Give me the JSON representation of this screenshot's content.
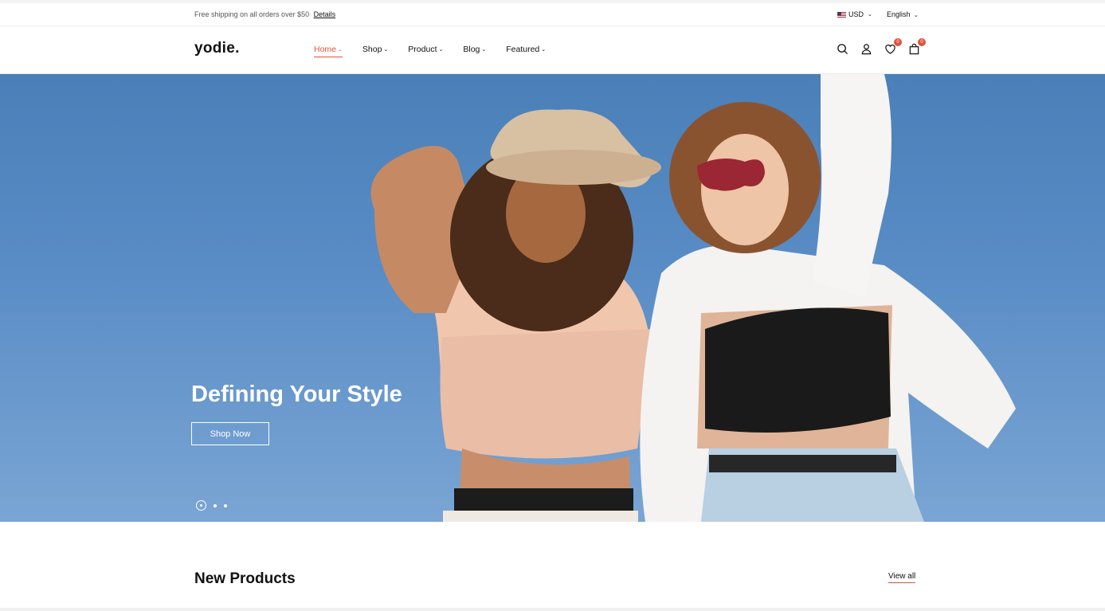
{
  "topbar": {
    "shipping_text": "Free shipping on all orders over $50",
    "details_link": "Details",
    "currency": "USD",
    "language": "English"
  },
  "header": {
    "logo": "yodie.",
    "nav": [
      {
        "label": "Home",
        "active": true
      },
      {
        "label": "Shop",
        "active": false
      },
      {
        "label": "Product",
        "active": false
      },
      {
        "label": "Blog",
        "active": false
      },
      {
        "label": "Featured",
        "active": false
      }
    ],
    "icons": [
      "search-icon",
      "account-icon",
      "wishlist-icon",
      "cart-icon"
    ],
    "wishlist_count": "0",
    "cart_count": "0"
  },
  "hero": {
    "title": "Defining Your Style",
    "button_label": "Shop Now",
    "slides": 3,
    "active_slide": 1
  },
  "new_products": {
    "title": "New Products",
    "view_all": "View all"
  },
  "colors": {
    "accent": "#e1523d",
    "sky": "#5a8dc6"
  }
}
